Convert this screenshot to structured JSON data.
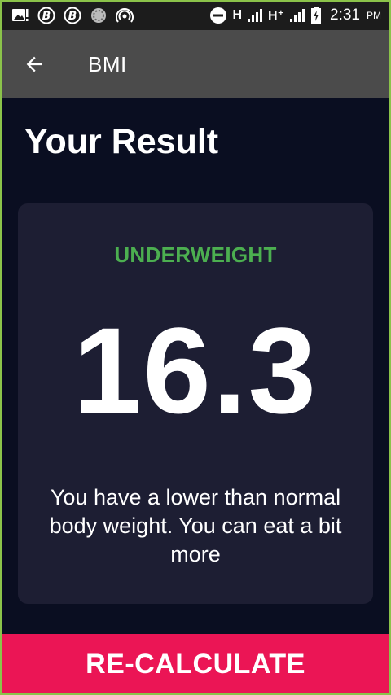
{
  "status_bar": {
    "network_1": "H",
    "network_2": "H⁺",
    "time": "2:31",
    "ampm": "PM",
    "icons": [
      "image-alert-icon",
      "bitcoin-icon",
      "bitcoin-icon",
      "spinner-icon",
      "hotspot-icon",
      "do-not-disturb-icon",
      "signal-icon",
      "signal-icon",
      "battery-charging-icon"
    ]
  },
  "app_bar": {
    "title": "BMI",
    "back_icon": "arrow-back-icon"
  },
  "main": {
    "heading": "Your Result"
  },
  "result_card": {
    "category": "UNDERWEIGHT",
    "bmi": "16.3",
    "interpretation": "You have a lower than normal body weight. You can eat a bit more"
  },
  "bottom_button": {
    "label": "RE-CALCULATE"
  },
  "colors": {
    "background": "#0a0e21",
    "card": "#1d1e33",
    "app_bar": "#4b4b4b",
    "status_bar": "#1c1c1c",
    "category": "#4caf50",
    "button": "#eb1555",
    "frame": "#8bc34a"
  }
}
